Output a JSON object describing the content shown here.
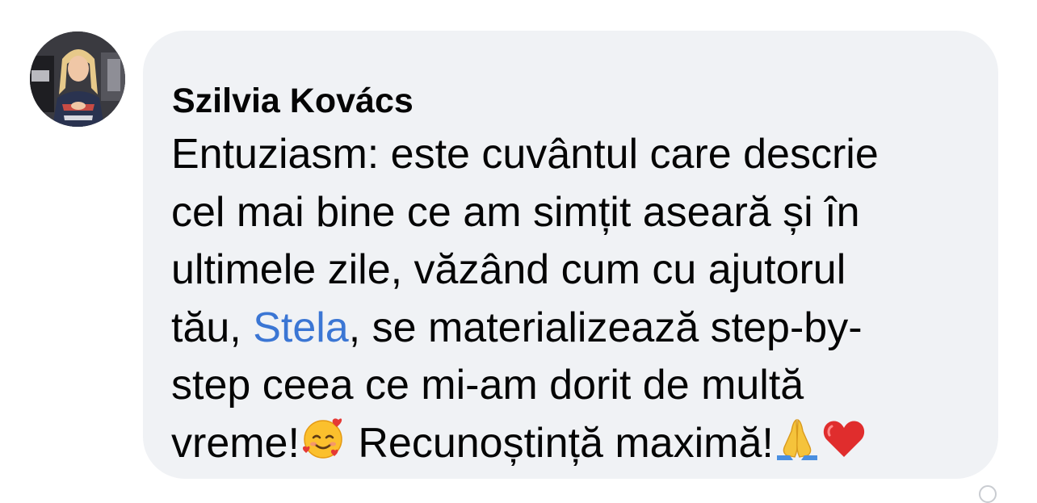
{
  "comment": {
    "author": "Szilvia Kovács",
    "lines": {
      "l1": "Entuziasm: este cuvântul care descrie",
      "l2": "cel mai bine ce am simțit aseară și în",
      "l3": "ultimele zile, văzând cum cu ajutorul",
      "l4_before": "tău, ",
      "l4_mention": "Stela",
      "l4_after": ", se materializează step-by-",
      "l5": "step ceea ce mi-am dorit de multă",
      "l6_before": "vreme!",
      "l6_middle": " Recunoștință maximă!"
    },
    "emojis": [
      "smiling-face-with-hearts-icon",
      "folded-hands-icon",
      "red-heart-icon"
    ]
  },
  "colors": {
    "bubble": "#f0f2f5",
    "text": "#050505",
    "mention": "#3b76d4"
  }
}
